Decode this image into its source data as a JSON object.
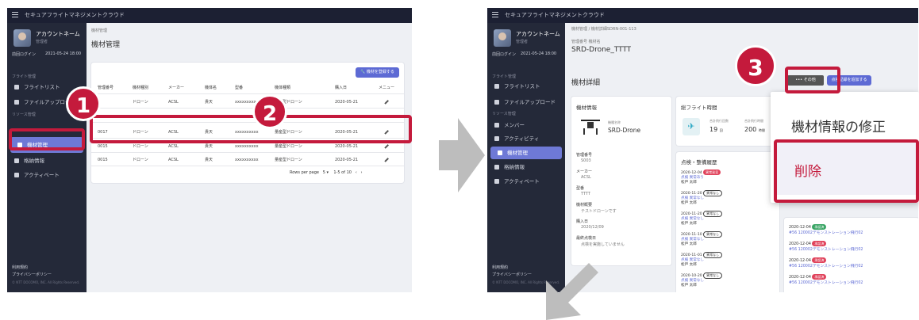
{
  "app_title": "セキュアフライトマネジメントクラウド",
  "user": {
    "name": "アカウントネーム",
    "role": "管理者",
    "last_login_label": "前回ログイン",
    "last_login": "2021-05-24 18:00"
  },
  "sidebar": {
    "flight_section": "フライト管理",
    "flight_items": [
      {
        "label": "フライトリスト"
      },
      {
        "label": "ファイルアップロード"
      }
    ],
    "resource_section": "リソース管理",
    "resource_items": [
      {
        "label": "メンバー"
      },
      {
        "label": "アクティビティ"
      },
      {
        "label": "機材管理"
      },
      {
        "label": "格納情報"
      },
      {
        "label": "アクティベート"
      }
    ],
    "footer_terms": "利用規約",
    "footer_privacy": "プライバシーポリシー",
    "copyright": "© NTT DOCOMO, INC. All Rights Reserved."
  },
  "screen1": {
    "breadcrumb": "機材管理",
    "title": "機材管理",
    "register_button": "機材を登録する",
    "columns": [
      "管理番号",
      "機材種別",
      "メーカー",
      "機体名",
      "型番",
      "機体種類",
      "購入日",
      "メニュー"
    ],
    "rows": [
      {
        "id": "",
        "type": "ドローン",
        "maker": "ACSL",
        "name": "貴天",
        "model": "xxxxxxxxxx",
        "category": "量産型ドローン",
        "date": "2020-05-21"
      },
      {
        "id": "",
        "type": "",
        "maker": "",
        "name": "",
        "model": "",
        "category": "",
        "date": ""
      },
      {
        "id": "0017",
        "type": "ドローン",
        "maker": "ACSL",
        "name": "貴天",
        "model": "xxxxxxxxxx",
        "category": "量産型ドローン",
        "date": "2020-05-21"
      },
      {
        "id": "0015",
        "type": "ドローン",
        "maker": "ACSL",
        "name": "貴天",
        "model": "xxxxxxxxxx",
        "category": "量産型ドローン",
        "date": "2020-05-21"
      },
      {
        "id": "0015",
        "type": "ドローン",
        "maker": "ACSL",
        "name": "貴天",
        "model": "xxxxxxxxxx",
        "category": "量産型ドローン",
        "date": "2020-05-21"
      }
    ],
    "pagination": {
      "rows_per_page_label": "Rows per page",
      "rows_per_page": "5",
      "range": "1-5 of 10"
    }
  },
  "screen2": {
    "breadcrumb": "機材管理 / 機材詳細SDRN-001-113",
    "mgmt_label": "管理番号 機材名",
    "mgmt_value": "SRD-Drone_TTTT",
    "section_title": "機材詳細",
    "more_button": "その他",
    "add_inspection_button": "点検記録を追加する",
    "info_card": {
      "title": "機材情報",
      "name_label": "機種名称",
      "name": "SRD-Drone",
      "fields": [
        {
          "label": "管理番号",
          "value": "S003"
        },
        {
          "label": "メーカー",
          "value": "ACSL"
        },
        {
          "label": "型番",
          "value": "TTTT"
        },
        {
          "label": "機材概要",
          "value": "テストドローンです"
        },
        {
          "label": "購入日",
          "value": "2020/12/09"
        },
        {
          "label": "最終点検日",
          "value": "点検を実施していません"
        }
      ]
    },
    "flight_card": {
      "title": "総フライト時間",
      "count_label": "合計飛行回数",
      "count_value": "19",
      "count_unit": "回",
      "time_label": "合計飛行時間",
      "time_value": "200",
      "time_unit": "時間"
    },
    "inspection_card": {
      "title": "点検・整備履歴",
      "entries": [
        {
          "date": "2020-12-04",
          "tag": "異常発見",
          "tag_style": "red",
          "line1": "点検 異常あり",
          "line2": "松戸 太郎"
        },
        {
          "date": "2020-11-20",
          "tag": "異常なし",
          "tag_style": "out",
          "line1": "点検 異常なし",
          "line2": "松戸 太郎"
        },
        {
          "date": "2020-11-20",
          "tag": "異常なし",
          "tag_style": "out",
          "line1": "点検 異常なし",
          "line2": "松戸 太郎"
        },
        {
          "date": "2020-11-10",
          "tag": "異常なし",
          "tag_style": "out",
          "line1": "点検 異常なし",
          "line2": "松戸 太郎"
        },
        {
          "date": "2020-11-01",
          "tag": "異常なし",
          "tag_style": "out",
          "line1": "点検 異常なし",
          "line2": "松戸 太郎"
        },
        {
          "date": "2020-10-20",
          "tag": "異常なし",
          "tag_style": "out",
          "line1": "点検 異常なし",
          "line2": "松戸 太郎"
        }
      ]
    },
    "flight_log": [
      {
        "date": "2020-12-04",
        "tag": "承認済",
        "tag_style": "green",
        "text": "#56 120002デモンストレーション飛行02"
      },
      {
        "date": "2020-12-04",
        "tag": "承認済",
        "tag_style": "red",
        "text": "#56 120002デモンストレーション飛行02"
      },
      {
        "date": "2020-12-04",
        "tag": "承認済",
        "tag_style": "red",
        "text": "#56 120002デモンストレーション飛行02"
      },
      {
        "date": "2020-12-04",
        "tag": "承認済",
        "tag_style": "red",
        "text": "#56 120002デモンストレーション飛行02"
      }
    ],
    "menu": {
      "edit": "機材情報の修正",
      "delete": "削除"
    }
  },
  "callouts": {
    "one": "1",
    "two": "2",
    "three": "3"
  },
  "colors": {
    "accent": "#c41a3c",
    "sidebar": "#242939",
    "primary": "#5d6ad4",
    "active": "#6e79d6"
  }
}
